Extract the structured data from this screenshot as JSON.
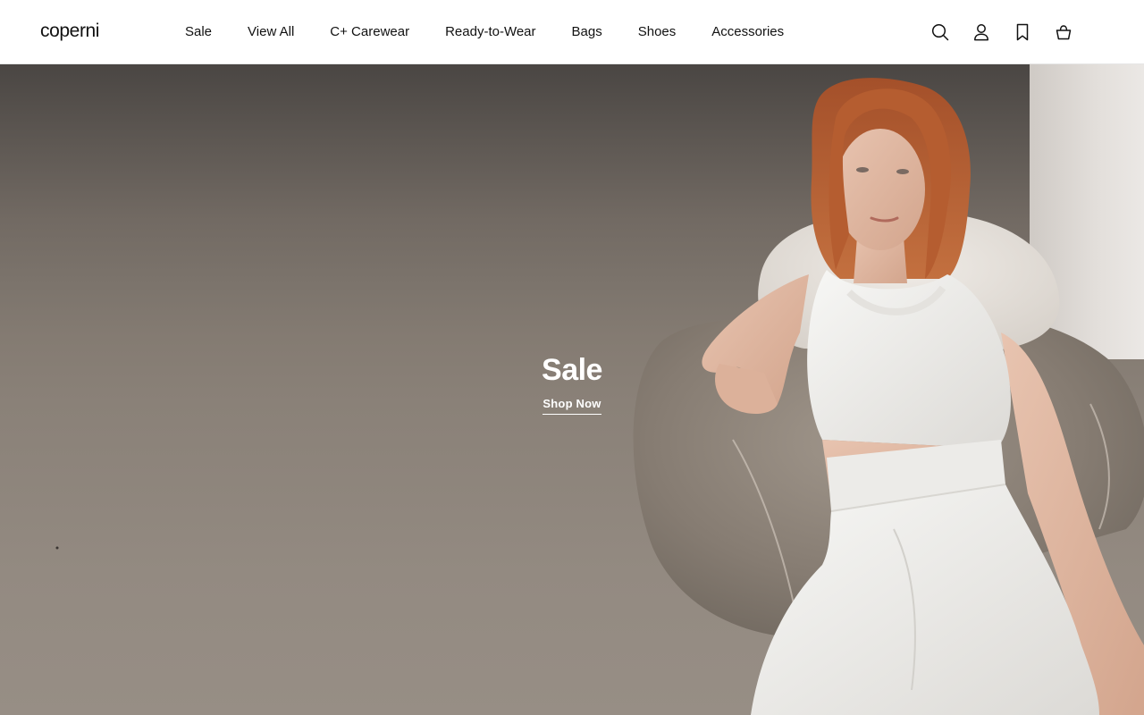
{
  "brand": {
    "name": "coperni"
  },
  "nav": {
    "items": [
      {
        "label": "Sale"
      },
      {
        "label": "View All"
      },
      {
        "label": "C+ Carewear"
      },
      {
        "label": "Ready-to-Wear"
      },
      {
        "label": "Bags"
      },
      {
        "label": "Shoes"
      },
      {
        "label": "Accessories"
      }
    ]
  },
  "actions": [
    {
      "icon": "search-icon"
    },
    {
      "icon": "user-icon"
    },
    {
      "icon": "bookmark-icon"
    },
    {
      "icon": "shopping-bag-icon"
    }
  ],
  "hero": {
    "title": "Sale",
    "cta_label": "Shop Now"
  },
  "colors": {
    "text": "#111111",
    "header_bg": "#ffffff",
    "hero_text": "#ffffff"
  }
}
